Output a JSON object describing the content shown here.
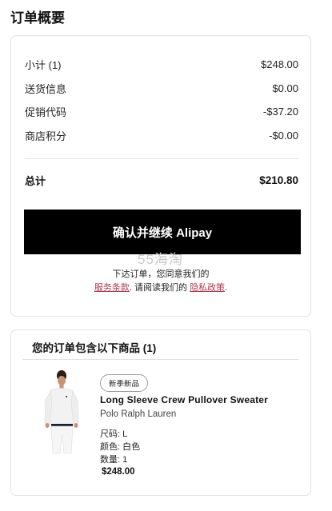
{
  "summary": {
    "title": "订单概要",
    "rows": [
      {
        "label": "小计 (1)",
        "value": "$248.00"
      },
      {
        "label": "送货信息",
        "value": "$0.00"
      },
      {
        "label": "促销代码",
        "value": "-$37.20"
      },
      {
        "label": "商店积分",
        "value": "-$0.00"
      }
    ],
    "total": {
      "label": "总计",
      "value": "$210.80"
    },
    "confirm_button": "确认并继续 Alipay",
    "watermark": "55海淘",
    "legal": {
      "line1": "下达订单，您同意我们的",
      "terms_link": "服务条款",
      "middle": ". 请阅读我们的",
      "privacy_link": "隐私政策",
      "end": "."
    }
  },
  "items": {
    "title": "您的订单包含以下商品 (1)",
    "product": {
      "badge": "新季新品",
      "name": "Long Sleeve Crew Pullover Sweater",
      "brand": "Polo Ralph Lauren",
      "size": "尺码:  L",
      "color": "颜色:  白色",
      "quantity": "数量:  1",
      "price": "$248.00"
    }
  }
}
